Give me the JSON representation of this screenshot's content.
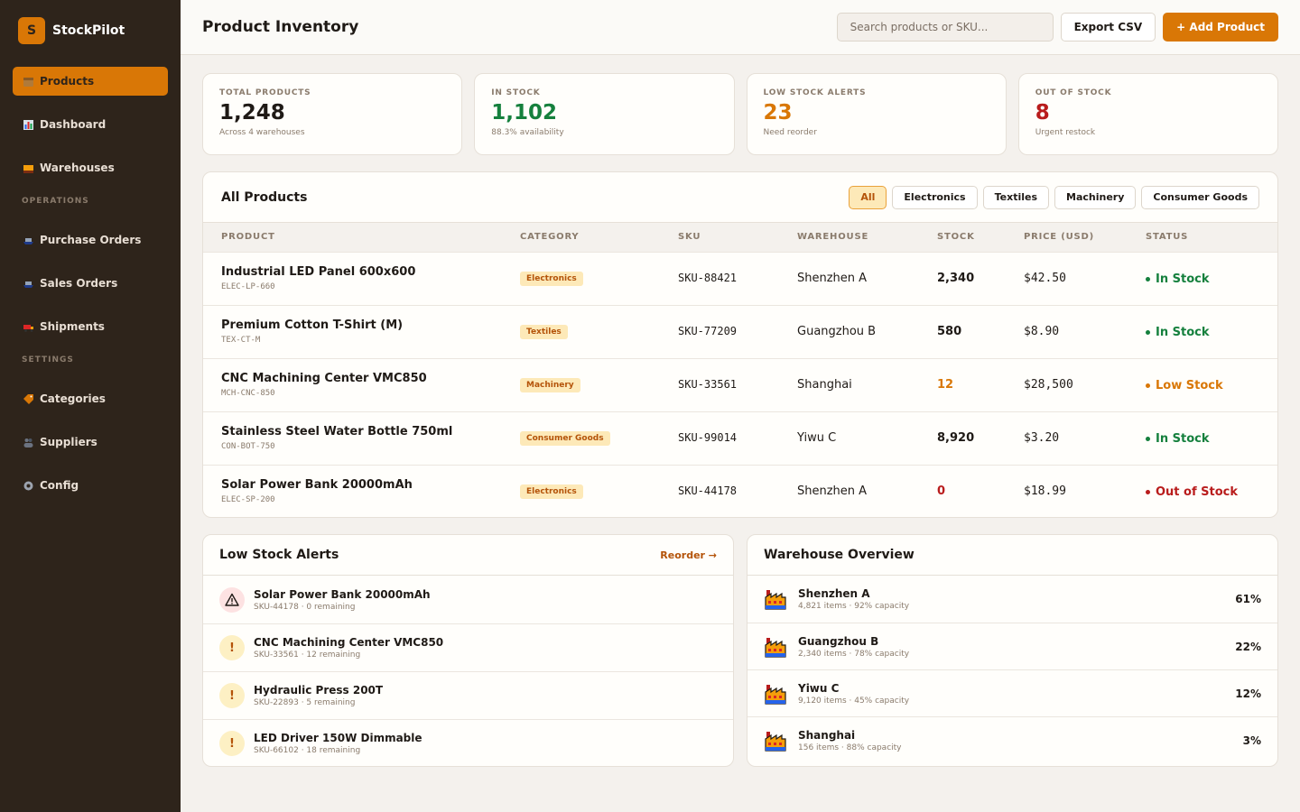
{
  "brand": {
    "logo_letter": "S",
    "name": "StockPilot"
  },
  "sidebar": {
    "items": [
      {
        "label": "Products",
        "icon": "box-icon",
        "active": true
      },
      {
        "label": "Dashboard",
        "icon": "bar-chart-icon"
      },
      {
        "label": "Warehouses",
        "icon": "warehouse-icon"
      }
    ],
    "sections": [
      {
        "label": "OPERATIONS",
        "items": [
          {
            "label": "Purchase Orders",
            "icon": "ship-icon"
          },
          {
            "label": "Sales Orders",
            "icon": "ship-icon"
          },
          {
            "label": "Shipments",
            "icon": "truck-icon"
          }
        ]
      },
      {
        "label": "SETTINGS",
        "items": [
          {
            "label": "Categories",
            "icon": "tag-icon"
          },
          {
            "label": "Suppliers",
            "icon": "users-icon"
          },
          {
            "label": "Config",
            "icon": "gear-icon"
          }
        ]
      }
    ]
  },
  "header": {
    "title": "Product Inventory",
    "search_placeholder": "Search products or SKU...",
    "export_label": "Export CSV",
    "add_label": "+ Add Product"
  },
  "stats": [
    {
      "label": "TOTAL PRODUCTS",
      "value": "1,248",
      "sub": "Across 4 warehouses",
      "color": "#1f1a16"
    },
    {
      "label": "IN STOCK",
      "value": "1,102",
      "sub": "88.3% availability",
      "color": "#15803d"
    },
    {
      "label": "LOW STOCK ALERTS",
      "value": "23",
      "sub": "Need reorder",
      "color": "#d97706"
    },
    {
      "label": "OUT OF STOCK",
      "value": "8",
      "sub": "Urgent restock",
      "color": "#b91c1c"
    }
  ],
  "products": {
    "title": "All Products",
    "filters": [
      "All",
      "Electronics",
      "Textiles",
      "Machinery",
      "Consumer Goods"
    ],
    "active_filter": "All",
    "columns": [
      "PRODUCT",
      "CATEGORY",
      "SKU",
      "WAREHOUSE",
      "STOCK",
      "PRICE (USD)",
      "STATUS"
    ],
    "rows": [
      {
        "name": "Industrial LED Panel 600x600",
        "code": "ELEC-LP-660",
        "category": "Electronics",
        "sku": "SKU-88421",
        "warehouse": "Shenzhen A",
        "stock": "2,340",
        "price": "$42.50",
        "status": "In Stock",
        "status_color": "#15803d",
        "stock_color": "#1f1a16"
      },
      {
        "name": "Premium Cotton T-Shirt (M)",
        "code": "TEX-CT-M",
        "category": "Textiles",
        "sku": "SKU-77209",
        "warehouse": "Guangzhou B",
        "stock": "580",
        "price": "$8.90",
        "status": "In Stock",
        "status_color": "#15803d",
        "stock_color": "#1f1a16"
      },
      {
        "name": "CNC Machining Center VMC850",
        "code": "MCH-CNC-850",
        "category": "Machinery",
        "sku": "SKU-33561",
        "warehouse": "Shanghai",
        "stock": "12",
        "price": "$28,500",
        "status": "Low Stock",
        "status_color": "#d97706",
        "stock_color": "#d97706"
      },
      {
        "name": "Stainless Steel Water Bottle 750ml",
        "code": "CON-BOT-750",
        "category": "Consumer Goods",
        "sku": "SKU-99014",
        "warehouse": "Yiwu C",
        "stock": "8,920",
        "price": "$3.20",
        "status": "In Stock",
        "status_color": "#15803d",
        "stock_color": "#1f1a16"
      },
      {
        "name": "Solar Power Bank 20000mAh",
        "code": "ELEC-SP-200",
        "category": "Electronics",
        "sku": "SKU-44178",
        "warehouse": "Shenzhen A",
        "stock": "0",
        "price": "$18.99",
        "status": "Out of Stock",
        "status_color": "#b91c1c",
        "stock_color": "#b91c1c"
      }
    ]
  },
  "alerts": {
    "title": "Low Stock Alerts",
    "link": "Reorder →",
    "items": [
      {
        "name": "Solar Power Bank 20000mAh",
        "sub": "SKU-44178 · 0 remaining",
        "level": "danger",
        "icon": "warning-triangle-icon"
      },
      {
        "name": "CNC Machining Center VMC850",
        "sub": "SKU-33561 · 12 remaining",
        "level": "warn",
        "icon": "exclamation-icon"
      },
      {
        "name": "Hydraulic Press 200T",
        "sub": "SKU-22893 · 5 remaining",
        "level": "warn",
        "icon": "exclamation-icon"
      },
      {
        "name": "LED Driver 150W Dimmable",
        "sub": "SKU-66102 · 18 remaining",
        "level": "warn",
        "icon": "exclamation-icon"
      }
    ]
  },
  "warehouses": {
    "title": "Warehouse Overview",
    "items": [
      {
        "name": "Shenzhen A",
        "sub": "4,821 items · 92% capacity",
        "pct": "61%"
      },
      {
        "name": "Guangzhou B",
        "sub": "2,340 items · 78% capacity",
        "pct": "22%"
      },
      {
        "name": "Yiwu C",
        "sub": "9,120 items · 45% capacity",
        "pct": "12%"
      },
      {
        "name": "Shanghai",
        "sub": "156 items · 88% capacity",
        "pct": "3%"
      }
    ]
  }
}
